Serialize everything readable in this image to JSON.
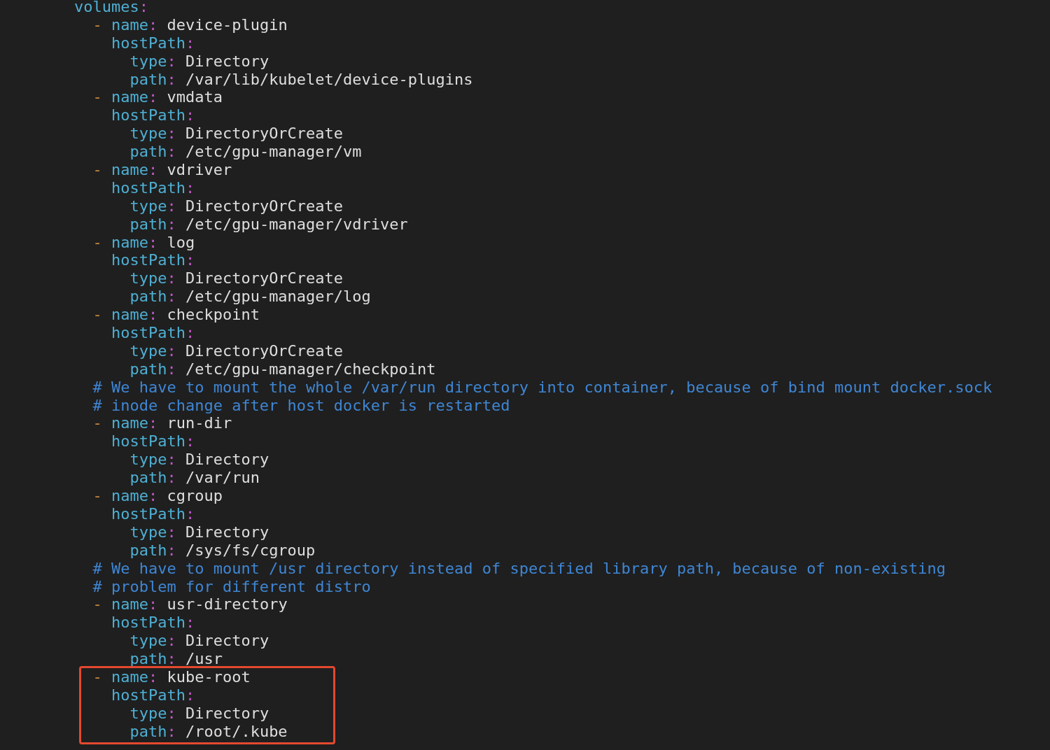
{
  "editor": {
    "lines": [
      {
        "tokens": [
          {
            "kind": "key",
            "text": "        volumes"
          },
          {
            "kind": "colon",
            "text": ":"
          }
        ]
      },
      {
        "tokens": [
          {
            "kind": "dash",
            "text": "          -"
          },
          {
            "kind": "key",
            "text": " name"
          },
          {
            "kind": "colon",
            "text": ":"
          },
          {
            "kind": "value",
            "text": " device-plugin"
          }
        ]
      },
      {
        "tokens": [
          {
            "kind": "key",
            "text": "            hostPath"
          },
          {
            "kind": "colon",
            "text": ":"
          }
        ]
      },
      {
        "tokens": [
          {
            "kind": "key",
            "text": "              type"
          },
          {
            "kind": "colon",
            "text": ":"
          },
          {
            "kind": "value",
            "text": " Directory"
          }
        ]
      },
      {
        "tokens": [
          {
            "kind": "key",
            "text": "              path"
          },
          {
            "kind": "colon",
            "text": ":"
          },
          {
            "kind": "value",
            "text": " /var/lib/kubelet/device-plugins"
          }
        ]
      },
      {
        "tokens": [
          {
            "kind": "dash",
            "text": "          -"
          },
          {
            "kind": "key",
            "text": " name"
          },
          {
            "kind": "colon",
            "text": ":"
          },
          {
            "kind": "value",
            "text": " vmdata"
          }
        ]
      },
      {
        "tokens": [
          {
            "kind": "key",
            "text": "            hostPath"
          },
          {
            "kind": "colon",
            "text": ":"
          }
        ]
      },
      {
        "tokens": [
          {
            "kind": "key",
            "text": "              type"
          },
          {
            "kind": "colon",
            "text": ":"
          },
          {
            "kind": "value",
            "text": " DirectoryOrCreate"
          }
        ]
      },
      {
        "tokens": [
          {
            "kind": "key",
            "text": "              path"
          },
          {
            "kind": "colon",
            "text": ":"
          },
          {
            "kind": "value",
            "text": " /etc/gpu-manager/vm"
          }
        ]
      },
      {
        "tokens": [
          {
            "kind": "dash",
            "text": "          -"
          },
          {
            "kind": "key",
            "text": " name"
          },
          {
            "kind": "colon",
            "text": ":"
          },
          {
            "kind": "value",
            "text": " vdriver"
          }
        ]
      },
      {
        "tokens": [
          {
            "kind": "key",
            "text": "            hostPath"
          },
          {
            "kind": "colon",
            "text": ":"
          }
        ]
      },
      {
        "tokens": [
          {
            "kind": "key",
            "text": "              type"
          },
          {
            "kind": "colon",
            "text": ":"
          },
          {
            "kind": "value",
            "text": " DirectoryOrCreate"
          }
        ]
      },
      {
        "tokens": [
          {
            "kind": "key",
            "text": "              path"
          },
          {
            "kind": "colon",
            "text": ":"
          },
          {
            "kind": "value",
            "text": " /etc/gpu-manager/vdriver"
          }
        ]
      },
      {
        "tokens": [
          {
            "kind": "dash",
            "text": "          -"
          },
          {
            "kind": "key",
            "text": " name"
          },
          {
            "kind": "colon",
            "text": ":"
          },
          {
            "kind": "value",
            "text": " log"
          }
        ]
      },
      {
        "tokens": [
          {
            "kind": "key",
            "text": "            hostPath"
          },
          {
            "kind": "colon",
            "text": ":"
          }
        ]
      },
      {
        "tokens": [
          {
            "kind": "key",
            "text": "              type"
          },
          {
            "kind": "colon",
            "text": ":"
          },
          {
            "kind": "value",
            "text": " DirectoryOrCreate"
          }
        ]
      },
      {
        "tokens": [
          {
            "kind": "key",
            "text": "              path"
          },
          {
            "kind": "colon",
            "text": ":"
          },
          {
            "kind": "value",
            "text": " /etc/gpu-manager/log"
          }
        ]
      },
      {
        "tokens": [
          {
            "kind": "dash",
            "text": "          -"
          },
          {
            "kind": "key",
            "text": " name"
          },
          {
            "kind": "colon",
            "text": ":"
          },
          {
            "kind": "value",
            "text": " checkpoint"
          }
        ]
      },
      {
        "tokens": [
          {
            "kind": "key",
            "text": "            hostPath"
          },
          {
            "kind": "colon",
            "text": ":"
          }
        ]
      },
      {
        "tokens": [
          {
            "kind": "key",
            "text": "              type"
          },
          {
            "kind": "colon",
            "text": ":"
          },
          {
            "kind": "value",
            "text": " DirectoryOrCreate"
          }
        ]
      },
      {
        "tokens": [
          {
            "kind": "key",
            "text": "              path"
          },
          {
            "kind": "colon",
            "text": ":"
          },
          {
            "kind": "value",
            "text": " /etc/gpu-manager/checkpoint"
          }
        ]
      },
      {
        "tokens": [
          {
            "kind": "comment",
            "text": "          # We have to mount the whole /var/run directory into container, because of bind mount docker.sock"
          }
        ]
      },
      {
        "tokens": [
          {
            "kind": "comment",
            "text": "          # inode change after host docker is restarted"
          }
        ]
      },
      {
        "tokens": [
          {
            "kind": "dash",
            "text": "          -"
          },
          {
            "kind": "key",
            "text": " name"
          },
          {
            "kind": "colon",
            "text": ":"
          },
          {
            "kind": "value",
            "text": " run-dir"
          }
        ]
      },
      {
        "tokens": [
          {
            "kind": "key",
            "text": "            hostPath"
          },
          {
            "kind": "colon",
            "text": ":"
          }
        ]
      },
      {
        "tokens": [
          {
            "kind": "key",
            "text": "              type"
          },
          {
            "kind": "colon",
            "text": ":"
          },
          {
            "kind": "value",
            "text": " Directory"
          }
        ]
      },
      {
        "tokens": [
          {
            "kind": "key",
            "text": "              path"
          },
          {
            "kind": "colon",
            "text": ":"
          },
          {
            "kind": "value",
            "text": " /var/run"
          }
        ]
      },
      {
        "tokens": [
          {
            "kind": "dash",
            "text": "          -"
          },
          {
            "kind": "key",
            "text": " name"
          },
          {
            "kind": "colon",
            "text": ":"
          },
          {
            "kind": "value",
            "text": " cgroup"
          }
        ]
      },
      {
        "tokens": [
          {
            "kind": "key",
            "text": "            hostPath"
          },
          {
            "kind": "colon",
            "text": ":"
          }
        ]
      },
      {
        "tokens": [
          {
            "kind": "key",
            "text": "              type"
          },
          {
            "kind": "colon",
            "text": ":"
          },
          {
            "kind": "value",
            "text": " Directory"
          }
        ]
      },
      {
        "tokens": [
          {
            "kind": "key",
            "text": "              path"
          },
          {
            "kind": "colon",
            "text": ":"
          },
          {
            "kind": "value",
            "text": " /sys/fs/cgroup"
          }
        ]
      },
      {
        "tokens": [
          {
            "kind": "comment",
            "text": "          # We have to mount /usr directory instead of specified library path, because of non-existing"
          }
        ]
      },
      {
        "tokens": [
          {
            "kind": "comment",
            "text": "          # problem for different distro"
          }
        ]
      },
      {
        "tokens": [
          {
            "kind": "dash",
            "text": "          -"
          },
          {
            "kind": "key",
            "text": " name"
          },
          {
            "kind": "colon",
            "text": ":"
          },
          {
            "kind": "value",
            "text": " usr-directory"
          }
        ]
      },
      {
        "tokens": [
          {
            "kind": "key",
            "text": "            hostPath"
          },
          {
            "kind": "colon",
            "text": ":"
          }
        ]
      },
      {
        "tokens": [
          {
            "kind": "key",
            "text": "              type"
          },
          {
            "kind": "colon",
            "text": ":"
          },
          {
            "kind": "value",
            "text": " Directory"
          }
        ]
      },
      {
        "tokens": [
          {
            "kind": "key",
            "text": "              path"
          },
          {
            "kind": "colon",
            "text": ":"
          },
          {
            "kind": "value",
            "text": " /usr"
          }
        ]
      }
    ],
    "highlight_box": {
      "lines": [
        {
          "tokens": [
            {
              "kind": "dash",
              "text": "          -"
            },
            {
              "kind": "key",
              "text": " name"
            },
            {
              "kind": "colon",
              "text": ":"
            },
            {
              "kind": "value",
              "text": " kube-root"
            }
          ]
        },
        {
          "tokens": [
            {
              "kind": "key",
              "text": "            hostPath"
            },
            {
              "kind": "colon",
              "text": ":"
            }
          ]
        },
        {
          "tokens": [
            {
              "kind": "key",
              "text": "              type"
            },
            {
              "kind": "colon",
              "text": ":"
            },
            {
              "kind": "value",
              "text": " Directory"
            }
          ]
        },
        {
          "tokens": [
            {
              "kind": "key",
              "text": "              path"
            },
            {
              "kind": "colon",
              "text": ":"
            },
            {
              "kind": "value",
              "text": " /root/.kube"
            }
          ]
        }
      ]
    }
  }
}
